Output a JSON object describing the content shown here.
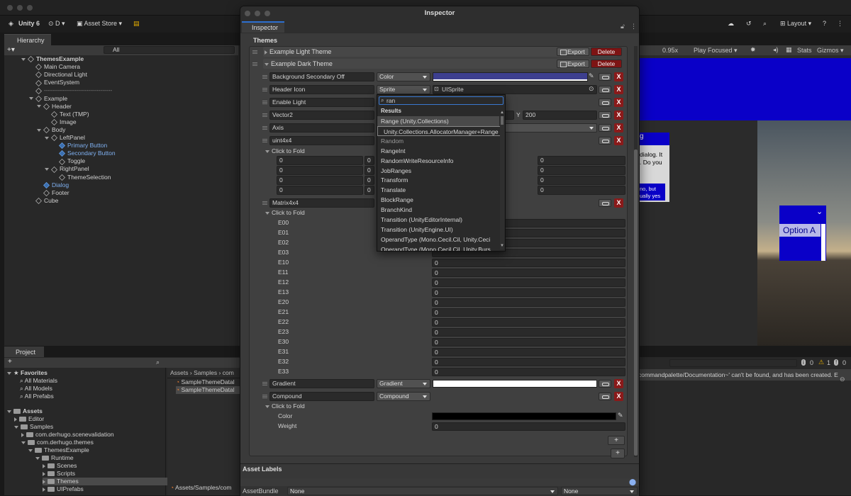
{
  "toolbar": {
    "app_name": "Unity 6",
    "account": "D",
    "asset_store": "Asset Store",
    "layout": "Layout"
  },
  "hierarchy": {
    "tab": "Hierarchy",
    "search_placeholder": "All",
    "items": [
      {
        "label": "ThemesExample",
        "depth": 0,
        "kind": "scene",
        "expanded": true
      },
      {
        "label": "Main Camera",
        "depth": 1
      },
      {
        "label": "Directional Light",
        "depth": 1
      },
      {
        "label": "EventSystem",
        "depth": 1
      },
      {
        "label": "----------------------------------",
        "depth": 1
      },
      {
        "label": "Example",
        "depth": 1,
        "expanded": true
      },
      {
        "label": "Header",
        "depth": 2,
        "expanded": true
      },
      {
        "label": "Text (TMP)",
        "depth": 3
      },
      {
        "label": "Image",
        "depth": 3
      },
      {
        "label": "Body",
        "depth": 2,
        "expanded": true
      },
      {
        "label": "LeftPanel",
        "depth": 3,
        "expanded": true
      },
      {
        "label": "Primary Button",
        "depth": 4,
        "blue": true
      },
      {
        "label": "Secondary Button",
        "depth": 4,
        "blue": true
      },
      {
        "label": "Toggle",
        "depth": 4
      },
      {
        "label": "RightPanel",
        "depth": 3,
        "expanded": true
      },
      {
        "label": "ThemeSelection",
        "depth": 4
      },
      {
        "label": "Dialog",
        "depth": 2,
        "blue": true
      },
      {
        "label": "Footer",
        "depth": 2
      },
      {
        "label": "Cube",
        "depth": 1
      }
    ]
  },
  "scene": {
    "zoom": "0.95x",
    "play_mode": "Play Focused",
    "stats": "Stats",
    "gizmos": "Gizmos",
    "dialog_title": "g",
    "dialog_text1": "dialog. It",
    "dialog_text2": ". Do you",
    "dialog_btn1": "no, but",
    "dialog_btn2": "ually yes",
    "dropdown_option": "Option A"
  },
  "project": {
    "tab": "Project",
    "favorites": "Favorites",
    "fav_items": [
      "All Materials",
      "All Models",
      "All Prefabs"
    ],
    "assets": "Assets",
    "tree": [
      {
        "label": "Editor",
        "depth": 1
      },
      {
        "label": "Samples",
        "depth": 1
      },
      {
        "label": "com.derhugo.scenevalidation",
        "depth": 2
      },
      {
        "label": "com.derhugo.themes",
        "depth": 2
      },
      {
        "label": "ThemesExample",
        "depth": 3
      },
      {
        "label": "Runtime",
        "depth": 4
      },
      {
        "label": "Scenes",
        "depth": 5
      },
      {
        "label": "Scripts",
        "depth": 5
      },
      {
        "label": "Themes",
        "depth": 5
      },
      {
        "label": "UIPrefabs",
        "depth": 5
      }
    ],
    "breadcrumb": [
      "Assets",
      "Samples",
      "com"
    ],
    "files": [
      "SampleThemeDatal",
      "SampleThemeDatal"
    ],
    "footer_path": "Assets/Samples/com"
  },
  "console": {
    "message": "commandpalette/Documentation~' can't be found, and has been created. E",
    "count_info": "0",
    "count_warn": "1",
    "count_err": "0"
  },
  "inspector": {
    "window_title": "Inspector",
    "tab": "Inspector",
    "section": "Themes",
    "themes": [
      {
        "name": "Example Light Theme",
        "export": "Export",
        "delete": "Delete"
      },
      {
        "name": "Example Dark Theme",
        "export": "Export",
        "delete": "Delete"
      }
    ],
    "rows": {
      "bg_secondary": {
        "name": "Background Secondary Off",
        "type": "Color",
        "color": "#3d3f8f"
      },
      "header_icon": {
        "name": "Header Icon",
        "type": "Sprite",
        "value": "UISprite"
      },
      "enable_light": {
        "name": "Enable Light"
      },
      "vector2": {
        "name": "Vector2",
        "y_label": "Y",
        "y_value": "200"
      },
      "axis": {
        "name": "Axis"
      },
      "uint4x4": {
        "name": "uint4x4",
        "fold": "Click to Fold",
        "cells": [
          "0",
          "0",
          "0",
          "0",
          "0",
          "0",
          "0",
          "0"
        ],
        "right_cells": [
          "0",
          "0",
          "0",
          "0"
        ]
      },
      "matrix": {
        "name": "Matrix4x4",
        "fold": "Click to Fold",
        "entries": [
          {
            "k": "E00",
            "v": ""
          },
          {
            "k": "E01",
            "v": ""
          },
          {
            "k": "E02",
            "v": ""
          },
          {
            "k": "E03",
            "v": ""
          },
          {
            "k": "E10",
            "v": "0"
          },
          {
            "k": "E11",
            "v": "0"
          },
          {
            "k": "E12",
            "v": "0"
          },
          {
            "k": "E13",
            "v": "0"
          },
          {
            "k": "E20",
            "v": "0"
          },
          {
            "k": "E21",
            "v": "0"
          },
          {
            "k": "E22",
            "v": "0"
          },
          {
            "k": "E23",
            "v": "0"
          },
          {
            "k": "E30",
            "v": "0"
          },
          {
            "k": "E31",
            "v": "0"
          },
          {
            "k": "E32",
            "v": "0"
          },
          {
            "k": "E33",
            "v": "0"
          }
        ]
      },
      "gradient": {
        "name": "Gradient",
        "type": "Gradient"
      },
      "compound": {
        "name": "Compound",
        "type": "Compound",
        "fold": "Click to Fold",
        "color_label": "Color",
        "weight_label": "Weight",
        "weight_value": "0"
      }
    },
    "asset_labels": "Asset Labels",
    "asset_bundle": "AssetBundle",
    "bundle_value": "None",
    "bundle_variant": "None"
  },
  "popup": {
    "search": "ran",
    "header": "Results",
    "items": [
      "Range  (Unity.Collections)",
      "Unity.Collections.AllocatorManager+Range",
      "Random",
      "RangeInt",
      "RandomWriteResourceInfo",
      "JobRanges",
      "Transform",
      "Translate",
      "BlockRange",
      "BranchKind",
      "Transition  (UnityEditorInternal)",
      "Transition  (UnityEngine.UI)",
      "OperandType  (Mono.Cecil.Cil, Unity.Ceci",
      "OperandType  (Mono.Cecil.Cil, Unity.Burs"
    ]
  }
}
